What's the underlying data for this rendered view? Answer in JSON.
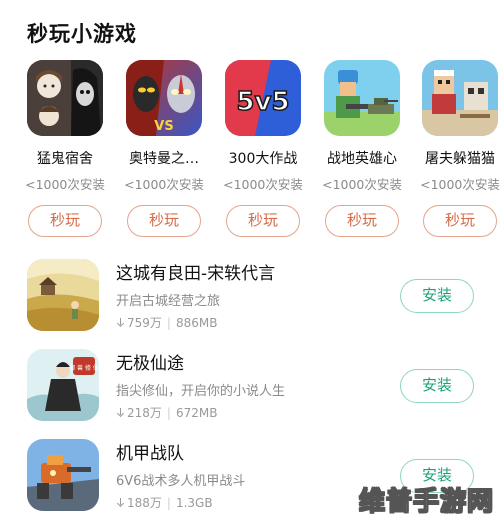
{
  "section_title": "秒玩小游戏",
  "mini_games": [
    {
      "name": "猛鬼宿舍",
      "installs": "<1000次安装",
      "button": "秒玩",
      "icon": "ghost-dorm-icon"
    },
    {
      "name": "奥特曼之…",
      "installs": "<1000次安装",
      "button": "秒玩",
      "icon": "ultraman-icon"
    },
    {
      "name": "300大作战",
      "installs": "<1000次安装",
      "button": "秒玩",
      "icon": "five-v-five-icon"
    },
    {
      "name": "战地英雄心",
      "installs": "<1000次安装",
      "button": "秒玩",
      "icon": "battlefield-hero-icon"
    },
    {
      "name": "屠夫躲猫猫",
      "installs": "<1000次安装",
      "button": "秒玩",
      "icon": "butcher-hide-seek-icon"
    }
  ],
  "icon_text": {
    "five_v_five": "5v5",
    "xianji_badge": "御 兽 修 仙"
  },
  "apps": [
    {
      "title": "这城有良田-宋轶代言",
      "desc": "开启古城经营之旅",
      "downloads": "759万",
      "size": "886MB",
      "button": "安装",
      "icon": "farmland-city-icon"
    },
    {
      "title": "无极仙途",
      "desc": "指尖修仙，开启你的小说人生",
      "downloads": "218万",
      "size": "672MB",
      "button": "安装",
      "icon": "immortal-path-icon"
    },
    {
      "title": "机甲战队",
      "desc": "6V6战术多人机甲战斗",
      "downloads": "188万",
      "size": "1.3GB",
      "button": "安装",
      "icon": "mecha-squad-icon"
    }
  ],
  "watermark": "维普手游网",
  "colors": {
    "play_button": "#d66b48",
    "install_button": "#1aa37a"
  }
}
